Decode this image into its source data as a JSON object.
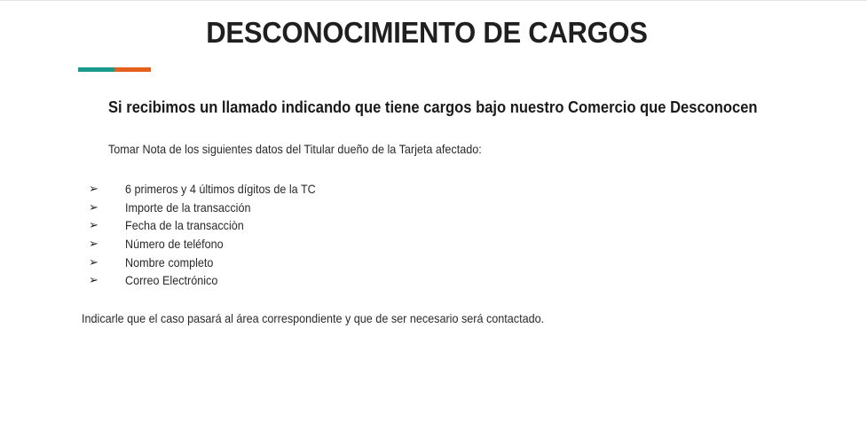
{
  "document": {
    "title": "DESCONOCIMIENTO DE CARGOS",
    "subheading": "Si recibimos un llamado indicando que tiene cargos bajo nuestro Comercio que Desconocen",
    "instruction": "Tomar Nota de los siguientes datos del Titular dueño de la Tarjeta afectado:",
    "bullet_symbol": "➢",
    "items": [
      "6 primeros y 4 últimos dígitos de la TC",
      "Importe de la transacción",
      "Fecha de la transacciòn",
      "Número de teléfono",
      "Nombre completo",
      "Correo Electrónico"
    ],
    "closing": "Indicarle que el caso pasará al área correspondiente y que de ser necesario será contactado."
  },
  "colors": {
    "accent_teal": "#1a9a8c",
    "accent_orange": "#e5601d",
    "text": "#222222"
  }
}
